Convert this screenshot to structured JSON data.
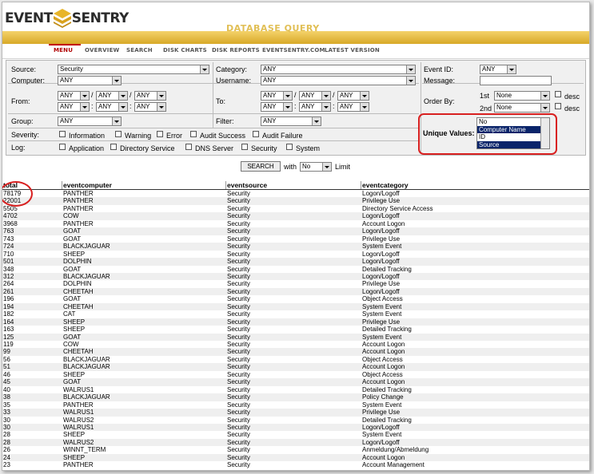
{
  "brand": {
    "word1": "EVENT",
    "word2": "SENTRY",
    "title": "DATABASE QUERY"
  },
  "nav": [
    "MENU",
    "OVERVIEW",
    "SEARCH",
    "DISK CHARTS",
    "DISK REPORTS",
    "EVENTSENTRY.COM",
    "LATEST VERSION"
  ],
  "form": {
    "source_label": "Source:",
    "source_value": "Security",
    "computer_label": "Computer:",
    "computer_value": "ANY",
    "from_label": "From:",
    "to_label": "To:",
    "any": "ANY",
    "group_label": "Group:",
    "group_value": "ANY",
    "category_label": "Category:",
    "category_value": "ANY",
    "username_label": "Username:",
    "username_value": "ANY",
    "filter_label": "Filter:",
    "filter_value": "ANY",
    "eventid_label": "Event ID:",
    "eventid_value": "ANY",
    "message_label": "Message:",
    "orderby_label": "Order By:",
    "first": "1st",
    "second": "2nd",
    "none": "None",
    "desc": "desc",
    "severity_label": "Severity:",
    "severity_options": [
      "Information",
      "Warning",
      "Error",
      "Audit Success",
      "Audit Failure"
    ],
    "log_label": "Log:",
    "log_options": [
      "Application",
      "Directory Service",
      "DNS Server",
      "Security",
      "System"
    ],
    "unique_label": "Unique Values:",
    "unique_options": [
      "No",
      "Computer Name",
      "ID",
      "Source"
    ],
    "search_button": "SEARCH",
    "with": "with",
    "limit_value": "No",
    "limit": "Limit"
  },
  "table": {
    "headers": [
      "total",
      "eventcomputer",
      "eventsource",
      "eventcategory"
    ],
    "rows": [
      [
        "78179",
        "PANTHER",
        "Security",
        "Logon/Logoff"
      ],
      [
        "22001",
        "PANTHER",
        "Security",
        "Privilege Use"
      ],
      [
        "5505",
        "PANTHER",
        "Security",
        "Directory Service Access"
      ],
      [
        "4702",
        "COW",
        "Security",
        "Logon/Logoff"
      ],
      [
        "3968",
        "PANTHER",
        "Security",
        "Account Logon"
      ],
      [
        "763",
        "GOAT",
        "Security",
        "Logon/Logoff"
      ],
      [
        "743",
        "GOAT",
        "Security",
        "Privilege Use"
      ],
      [
        "724",
        "BLACKJAGUAR",
        "Security",
        "System Event"
      ],
      [
        "710",
        "SHEEP",
        "Security",
        "Logon/Logoff"
      ],
      [
        "501",
        "DOLPHIN",
        "Security",
        "Logon/Logoff"
      ],
      [
        "348",
        "GOAT",
        "Security",
        "Detailed Tracking"
      ],
      [
        "312",
        "BLACKJAGUAR",
        "Security",
        "Logon/Logoff"
      ],
      [
        "264",
        "DOLPHIN",
        "Security",
        "Privilege Use"
      ],
      [
        "261",
        "CHEETAH",
        "Security",
        "Logon/Logoff"
      ],
      [
        "196",
        "GOAT",
        "Security",
        "Object Access"
      ],
      [
        "194",
        "CHEETAH",
        "Security",
        "System Event"
      ],
      [
        "182",
        "CAT",
        "Security",
        "System Event"
      ],
      [
        "164",
        "SHEEP",
        "Security",
        "Privilege Use"
      ],
      [
        "163",
        "SHEEP",
        "Security",
        "Detailed Tracking"
      ],
      [
        "125",
        "GOAT",
        "Security",
        "System Event"
      ],
      [
        "119",
        "COW",
        "Security",
        "Account Logon"
      ],
      [
        "99",
        "CHEETAH",
        "Security",
        "Account Logon"
      ],
      [
        "56",
        "BLACKJAGUAR",
        "Security",
        "Object Access"
      ],
      [
        "51",
        "BLACKJAGUAR",
        "Security",
        "Account Logon"
      ],
      [
        "46",
        "SHEEP",
        "Security",
        "Object Access"
      ],
      [
        "45",
        "GOAT",
        "Security",
        "Account Logon"
      ],
      [
        "40",
        "WALRUS1",
        "Security",
        "Detailed Tracking"
      ],
      [
        "38",
        "BLACKJAGUAR",
        "Security",
        "Policy Change"
      ],
      [
        "35",
        "PANTHER",
        "Security",
        "System Event"
      ],
      [
        "33",
        "WALRUS1",
        "Security",
        "Privilege Use"
      ],
      [
        "30",
        "WALRUS2",
        "Security",
        "Detailed Tracking"
      ],
      [
        "30",
        "WALRUS1",
        "Security",
        "Logon/Logoff"
      ],
      [
        "28",
        "SHEEP",
        "Security",
        "System Event"
      ],
      [
        "28",
        "WALRUS2",
        "Security",
        "Logon/Logoff"
      ],
      [
        "26",
        "WINNT_TERM",
        "Security",
        "Anmeldung/Abmeldung"
      ],
      [
        "24",
        "SHEEP",
        "Security",
        "Account Logon"
      ],
      [
        "23",
        "PANTHER",
        "Security",
        "Account Management"
      ]
    ]
  },
  "colors": {
    "gold": "#e1bf55",
    "highlight": "#d82020",
    "selection": "#0a246a"
  }
}
